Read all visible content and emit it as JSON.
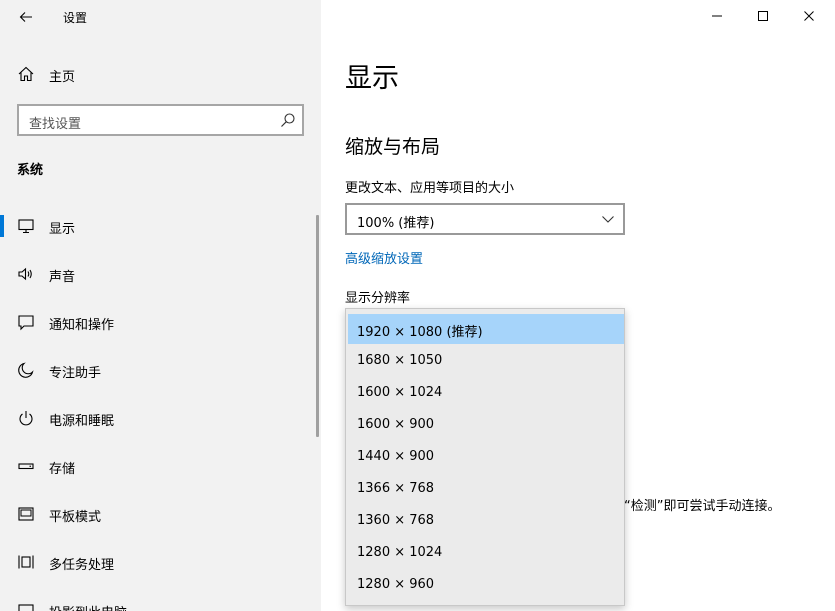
{
  "window": {
    "title": "设置",
    "controls": [
      "minimize",
      "maximize",
      "close"
    ]
  },
  "sidebar": {
    "home_label": "主页",
    "search_placeholder": "查找设置",
    "section_header": "系统",
    "items": [
      {
        "label": "显示",
        "icon": "monitor-icon",
        "active": true
      },
      {
        "label": "声音",
        "icon": "speaker-icon",
        "active": false
      },
      {
        "label": "通知和操作",
        "icon": "notification-icon",
        "active": false
      },
      {
        "label": "专注助手",
        "icon": "moon-icon",
        "active": false
      },
      {
        "label": "电源和睡眠",
        "icon": "power-icon",
        "active": false
      },
      {
        "label": "存储",
        "icon": "storage-icon",
        "active": false
      },
      {
        "label": "平板模式",
        "icon": "tablet-icon",
        "active": false
      },
      {
        "label": "多任务处理",
        "icon": "multitask-icon",
        "active": false
      },
      {
        "label": "投影到此电脑",
        "icon": "projector-icon",
        "active": false
      }
    ]
  },
  "main": {
    "title": "显示",
    "subtitle": "缩放与布局",
    "scale_label": "更改文本、应用等项目的大小",
    "scale_value": "100% (推荐)",
    "advanced_link": "高级缩放设置",
    "resolution_label": "显示分辨率",
    "partial_text": "“检测”即可尝试手动连接。"
  },
  "resolution_dropdown": {
    "selected_index": 0,
    "options": [
      "1920 × 1080 (推荐)",
      "1680 × 1050",
      "1600 × 1024",
      "1600 × 900",
      "1440 × 900",
      "1366 × 768",
      "1360 × 768",
      "1280 × 1024",
      "1280 × 960"
    ]
  },
  "colors": {
    "accent": "#0078d7",
    "link": "#0067b8",
    "sidebar_bg": "#f2f2f2",
    "selected_option": "#a6d4fa"
  }
}
